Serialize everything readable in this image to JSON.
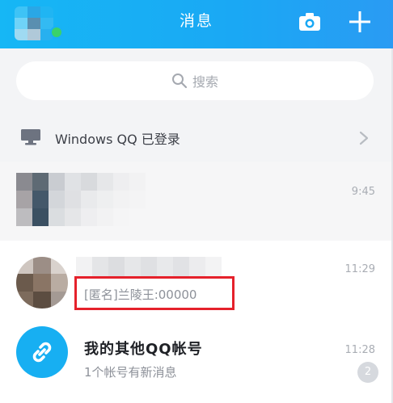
{
  "header": {
    "title": "消息",
    "camera_icon": "camera-icon",
    "plus_icon": "plus-icon",
    "accent": "#17aff2"
  },
  "search": {
    "placeholder": "搜索"
  },
  "login_status": {
    "text": "Windows QQ 已登录"
  },
  "conversations": [
    {
      "time": "9:45"
    },
    {
      "time": "11:29",
      "preview": "[匿名]兰陵王:00000"
    },
    {
      "title": "我的其他QQ帐号",
      "time": "11:28",
      "preview": "1个帐号有新消息",
      "badge": "2"
    }
  ]
}
